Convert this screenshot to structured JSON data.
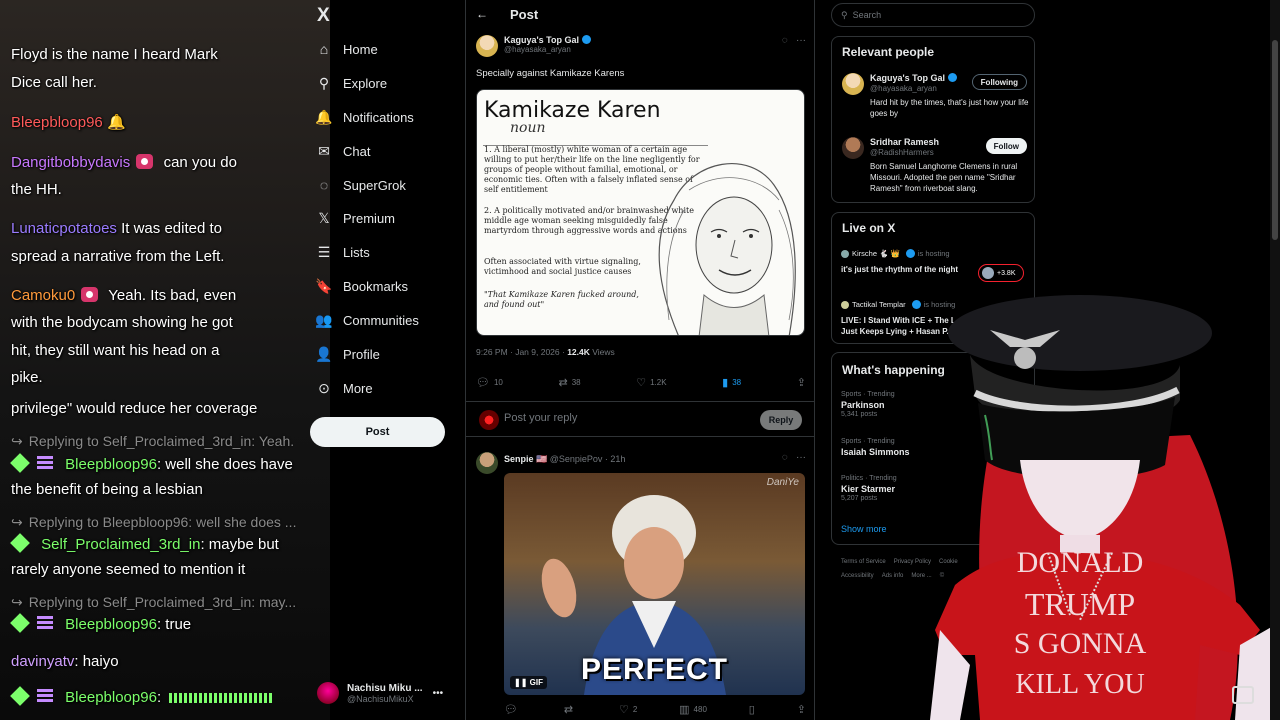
{
  "chat": {
    "lines": [
      {
        "text": "Floyd is the name I heard Mark"
      },
      {
        "text": "Dice call her."
      },
      {
        "user": "Bleepbloop96",
        "color": "#ff5a5a",
        "text": "🔔"
      },
      {
        "user": "Dangitbobbydavis",
        "color": "#c878ff",
        "text": "can you do"
      },
      {
        "text": "the HH."
      },
      {
        "user": "Lunaticpotatoes",
        "color": "#9b7cff",
        "text": "It was edited to"
      },
      {
        "text": "spread a narrative from the Left."
      },
      {
        "user": "Camoku0",
        "color": "#ff9a3c",
        "text": "Yeah. Its bad, even"
      },
      {
        "text": "with the bodycam showing he got"
      },
      {
        "text": "hit, they still want his head on a"
      },
      {
        "text": "pike."
      },
      {
        "text": "privilege\" would reduce her coverage"
      },
      {
        "reply": "Replying to Self_Proclaimed_3rd_in: Yeah."
      },
      {
        "user": "Bleepbloop96",
        "color": "#7cff6b",
        "text": "well she does have"
      },
      {
        "text": "the benefit of being a lesbian"
      },
      {
        "reply": "Replying to Bleepbloop96: well she does ..."
      },
      {
        "user": "Self_Proclaimed_3rd_in",
        "color": "#7cff6b",
        "text": "maybe but"
      },
      {
        "text": "rarely anyone seemed to mention it"
      },
      {
        "reply": "Replying to Self_Proclaimed_3rd_in: may..."
      },
      {
        "user": "Bleepbloop96",
        "color": "#7cff6b",
        "text": "true"
      },
      {
        "user": "davinyatv",
        "color": "#d0a0ff",
        "text": "haiyo"
      },
      {
        "user": "Bleepbloop96",
        "color": "#7cff6b",
        "text": ""
      }
    ]
  },
  "nav": {
    "logo": "X",
    "items": [
      {
        "label": "Home",
        "icon": "home-icon",
        "glyph": "⌂"
      },
      {
        "label": "Explore",
        "icon": "search-icon",
        "glyph": "⚲"
      },
      {
        "label": "Notifications",
        "icon": "bell-icon",
        "glyph": "🔔"
      },
      {
        "label": "Chat",
        "icon": "mail-icon",
        "glyph": "✉"
      },
      {
        "label": "SuperGrok",
        "icon": "grok-icon",
        "glyph": "◌"
      },
      {
        "label": "Premium",
        "icon": "x-premium-icon",
        "glyph": "𝕏"
      },
      {
        "label": "Lists",
        "icon": "list-icon",
        "glyph": "☰"
      },
      {
        "label": "Bookmarks",
        "icon": "bookmark-icon",
        "glyph": "🔖"
      },
      {
        "label": "Communities",
        "icon": "communities-icon",
        "glyph": "👥"
      },
      {
        "label": "Profile",
        "icon": "person-icon",
        "glyph": "👤"
      },
      {
        "label": "More",
        "icon": "more-circle-icon",
        "glyph": "⊙"
      }
    ],
    "post_button": "Post",
    "account": {
      "name": "Nachisu Miku ...",
      "handle": "@NachisuMikuX"
    }
  },
  "main": {
    "header_title": "Post",
    "tweet": {
      "author": "Kaguya's Top Gal",
      "handle": "@hayasaka_aryan",
      "text": "Specially against Kamikaze Karens",
      "image": {
        "title": "Kamikaze Karen",
        "pos": "noun",
        "def1": "1. A liberal (mostly) white woman of a certain age willing to put her/their life on the line negligently for groups of people without familial, emotional, or economic ties. Often with a falsely inflated sense of self entitlement",
        "def2": "2. A politically motivated and/or brainwashed white middle age woman seeking misguidedly false martyrdom through aggressive words and actions",
        "def3": "Often associated with virtue signaling, victimhood and social justice causes",
        "quote": "\"That Kamikaze Karen fucked around, and found out\""
      },
      "time": "9:26 PM · Jan 9, 2026 · ",
      "views": "12.4K",
      "views_label": " Views",
      "stats": {
        "replies": "10",
        "reposts": "38",
        "likes": "1.2K",
        "bookmarks": "38"
      }
    },
    "reply_placeholder": "Post your reply",
    "reply_button": "Reply",
    "tweet2": {
      "author": "Senpie 🇺🇸",
      "handle_time": "@SenpiePov · 21h",
      "gif_caption": "PERFECT",
      "gif_badge": "GIF",
      "watermark": "DaniYe",
      "stats": {
        "replies": "",
        "reposts": "",
        "likes": "2",
        "views": "480"
      }
    }
  },
  "right": {
    "search_placeholder": "Search",
    "relevant_title": "Relevant people",
    "people": [
      {
        "name": "Kaguya's Top Gal",
        "handle": "@hayasaka_aryan",
        "bio": "Hard hit by the times, that's just how your life goes by",
        "button": "Following"
      },
      {
        "name": "Sridhar Ramesh",
        "handle": "@RadishHarmers",
        "bio": "Born Samuel Langhorne Clemens in rural Missouri. Adopted the pen name \"Sridhar Ramesh\" from riverboat slang.",
        "button": "Follow"
      }
    ],
    "live_title": "Live on X",
    "live": [
      {
        "host": "Kirsche 🐇 👑",
        "hosting": "is hosting",
        "title": "it's just the rhythm of the night",
        "count": "+3.8K"
      },
      {
        "host": "Tactikal Templar",
        "hosting": "is hosting",
        "title": "LIVE: I Stand With ICE + The L... Just Keeps Lying + Hasan P..."
      }
    ],
    "happening_title": "What's happening",
    "trends": [
      {
        "cat": "Sports · Trending",
        "name": "Parkinson",
        "posts": "5,341 posts"
      },
      {
        "cat": "Sports · Trending",
        "name": "Isaiah Simmons",
        "posts": ""
      },
      {
        "cat": "Politics · Trending",
        "name": "Kier Starmer",
        "posts": "5,207 posts"
      }
    ],
    "show_more": "Show more",
    "footer1": [
      "Terms of Service",
      "Privacy Policy",
      "Cookie"
    ],
    "footer2": [
      "Accessibility",
      "Ads info",
      "More ...",
      "©"
    ]
  },
  "overlay": {
    "shirt_lines": [
      "DONALD",
      "TRUMP",
      "S GONNA",
      "KILL YOU"
    ]
  }
}
